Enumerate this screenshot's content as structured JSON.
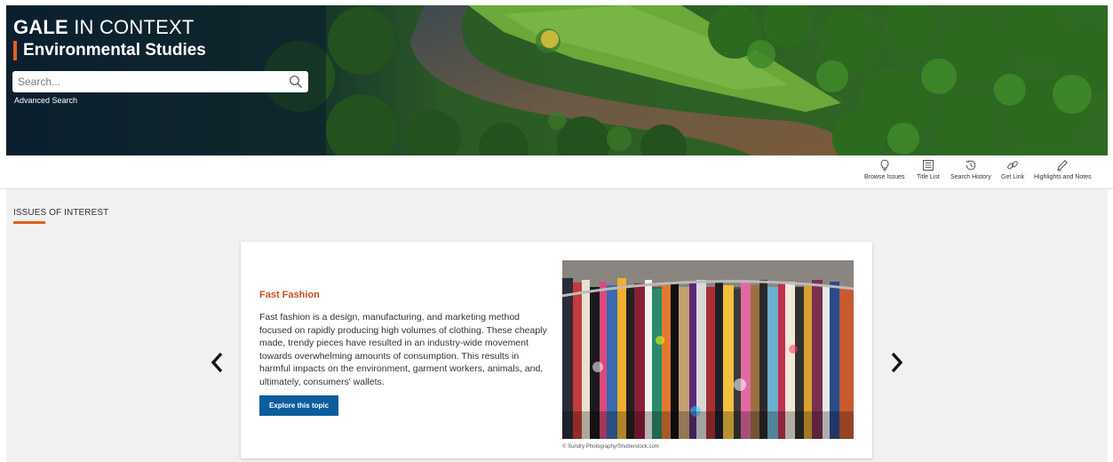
{
  "header": {
    "brand_bold": "GALE",
    "brand_light": " IN CONTEXT",
    "product": "Environmental Studies",
    "accent_color": "#e0601f",
    "search": {
      "placeholder": "Search...",
      "icon": "search-icon"
    },
    "advanced_search": "Advanced Search"
  },
  "toolbar": {
    "items": [
      {
        "label": "Browse Issues",
        "icon": "lightbulb-icon"
      },
      {
        "label": "Title List",
        "icon": "list-icon"
      },
      {
        "label": "Search History",
        "icon": "history-icon"
      },
      {
        "label": "Get Link",
        "icon": "link-icon"
      },
      {
        "label": "Highlights and Notes",
        "icon": "pencil-icon"
      }
    ]
  },
  "main": {
    "section_title": "ISSUES OF INTEREST",
    "carousel": {
      "prev_icon": "chevron-left-icon",
      "next_icon": "chevron-right-icon",
      "card": {
        "title": "Fast Fashion",
        "description": "Fast fashion is a design, manufacturing, and marketing method focused on rapidly producing high volumes of clothing. These cheaply made, trendy pieces have resulted in an industry-wide movement towards overwhelming amounts of consumption. This results in harmful impacts on the environment, garment workers, animals, and, ultimately, consumers' wallets.",
        "button_label": "Explore this topic",
        "button_color": "#0b5d9e",
        "image_credit": "© Sundry Photography/Shutterstock.com"
      }
    }
  }
}
